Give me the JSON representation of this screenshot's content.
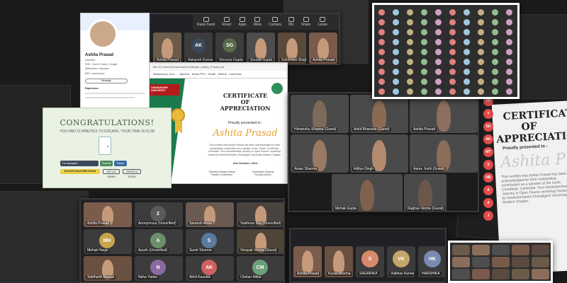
{
  "certificate": {
    "title_line1": "CERTIFICATE",
    "title_line2": "OF",
    "title_line3": "APPRECIATION",
    "presented": "Proudly presented to :",
    "name": "Ashita Prasad",
    "body": "This certifies that Ashita Prasad has been acknowledged for their outstanding contribution as a speaker at the \"Geek, Contribute, Celebrate: Your Hacktoberfest Journey in Open Source\" workshop hosted by GeeksforGeeks Chandigarh University Student Chapter.",
    "date": "2nd October, 2024",
    "sig1_name": "Shaveta Rangan Mehta",
    "sig1_role": "Faculty Coordinator",
    "sig2_name": "Sudhanshu Sharma",
    "sig2_role": "Faculty Advisor",
    "org": "CHANDIGARH UNIVERSITY"
  },
  "profile": {
    "name": "Ashita Prasad",
    "pronouns": "(she/her)",
    "line1": "SDE - Dart & Flutter | Google",
    "line2": "@flutterdev | Speaker",
    "followers": "500+ connections",
    "btn": "Message",
    "section": "Experience"
  },
  "game": {
    "title": "CONGRATULATIONS!",
    "subtitle": "YOU HAD 15 MINUTES TO ESCAPE. YOUR TIME IS 01:08",
    "input1": "I'm escaped",
    "btn1": "Submit",
    "btn2": "Tweet",
    "btn_main": "ESCAPE ANOTHER ROOM",
    "btn_a": "SET AS ADMIN",
    "btn_b": "CREATE A ROOM"
  },
  "meeting_toolbar": {
    "items": [
      "Raise hand",
      "React",
      "Apps",
      "More",
      "Camera",
      "Mic",
      "Share",
      "Leave"
    ]
  },
  "participants_top": [
    {
      "label": "Ashita Prasad",
      "initials": "",
      "color": "#6b5b4b"
    },
    {
      "label": "Aakansh Kumar",
      "initials": "AK",
      "color": "#3a4a5a"
    },
    {
      "label": "Shourya Gupta",
      "initials": "SG",
      "color": "#5a6a4a"
    },
    {
      "label": "Sourab Gupta",
      "initials": "",
      "color": "#4d4d4d"
    },
    {
      "label": "Sukhmeet Singh",
      "initials": "",
      "color": "#5b4a3a"
    },
    {
      "label": "Ashita Prasad",
      "initials": "",
      "color": "#7b5a4a"
    }
  ],
  "grid_right": [
    {
      "label": "Himanshu Sharma (Guest)",
      "tone": "#7d6a58"
    },
    {
      "label": "Ankit Bhandari (Guest)",
      "tone": "#8a6a52"
    },
    {
      "label": "Ashita Prasad",
      "tone": "#8e6e5e"
    },
    {
      "label": "Aman Sharma",
      "tone": "#9a7a62"
    },
    {
      "label": "Aditya Singh",
      "tone": "#b38a6e"
    },
    {
      "label": "Aarav Joshi (Guest)",
      "tone": "#8a6e5a"
    },
    {
      "label": "Mehak Gupta",
      "tone": "#7f6150"
    },
    {
      "label": "Raghav Verma (Guest)",
      "tone": "#6a564a"
    }
  ],
  "grid_bottom": [
    {
      "label": "Ashita Prasad",
      "initials": "",
      "color": "#7a5c4c"
    },
    {
      "label": "Anonymous (Unverified)",
      "initials": "2",
      "color": "#5a5a5a"
    },
    {
      "label": "Saransh Arora",
      "initials": "",
      "color": "#6a5a50"
    },
    {
      "label": "Vaishnav Dev (Unverified)",
      "initials": "",
      "color": "#4a4440"
    },
    {
      "label": "Mehak Harjai",
      "initials": "MH",
      "color": "#c9a44a"
    },
    {
      "label": "Ayush (Unverified)",
      "initials": "A",
      "color": "#6b8e6b"
    },
    {
      "label": "Sumit Sharma",
      "initials": "S",
      "color": "#5a7aa0"
    },
    {
      "label": "Vinayak Verma (Guest)",
      "initials": "",
      "color": "#4e4438"
    },
    {
      "label": "Siddharth Bansal",
      "initials": "",
      "color": "#6a5040"
    },
    {
      "label": "Neha Yadav",
      "initials": "N",
      "color": "#8a6aa0"
    },
    {
      "label": "Akhil Kaushik",
      "initials": "AK",
      "color": "#d06060"
    },
    {
      "label": "Chetan Mittal",
      "initials": "CM",
      "color": "#6aa07a"
    }
  ],
  "bottom_strip": [
    {
      "label": "Ashita Prasad",
      "initials": "",
      "color": "#7a5c4c"
    },
    {
      "label": "Kunal Sharma",
      "initials": "",
      "color": "#6a5040"
    },
    {
      "label": "SAGARIKA",
      "initials": "S",
      "color": "#d98a6a"
    },
    {
      "label": "Vaibhav Kumar",
      "initials": "VK",
      "color": "#c4a66a"
    },
    {
      "label": "HARSHIKA",
      "initials": "HK",
      "color": "#7a8ab0"
    }
  ],
  "side_strip": [
    "SH",
    "T",
    "SK",
    "AK",
    "MT",
    "S",
    "NB",
    "A",
    "A",
    "J"
  ],
  "big_cert": {
    "line1": "CERTIFICATE",
    "line2": "OF",
    "line3": "APPRECIATION",
    "presented": "Proudly presented to :",
    "name": "Ashita P",
    "body": "This certifies that Ashita Prasad has been acknowledged for their outstanding contribution as a speaker at the Geek, Contribute, Celebrate: Your Hacktoberfest Journey in Open Source workshop hosted by GeeksforGeeks Chandigarh University Student Chapter."
  }
}
